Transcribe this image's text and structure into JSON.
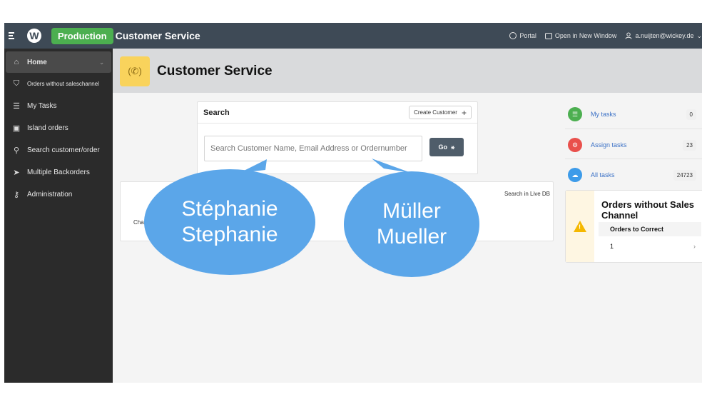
{
  "topbar": {
    "logo_letter": "W",
    "environment": "Production",
    "app_title": "Customer Service",
    "portal_label": "Portal",
    "open_window_label": "Open in New Window",
    "user_label": "a.nuijten@wickey.de"
  },
  "sidebar": {
    "items": [
      {
        "label": "Home",
        "icon": "home-icon"
      },
      {
        "label": "Orders without saleschannel",
        "icon": "shield-icon"
      },
      {
        "label": "My Tasks",
        "icon": "list-icon"
      },
      {
        "label": "Island orders",
        "icon": "gift-icon"
      },
      {
        "label": "Search customer/order",
        "icon": "search-icon"
      },
      {
        "label": "Multiple Backorders",
        "icon": "send-icon"
      },
      {
        "label": "Administration",
        "icon": "user-key-icon"
      }
    ]
  },
  "header": {
    "title": "Customer Service",
    "icon": "phone-ringing-icon"
  },
  "search": {
    "title": "Search",
    "create_label": "Create Customer",
    "placeholder": "Search Customer Name, Email Address or Ordernumber",
    "go_label": "Go"
  },
  "results": {
    "live_db_label": "Search in Live DB",
    "chan_label": "Chan"
  },
  "bubbles": {
    "left": {
      "line1": "Stéphanie",
      "line2": "Stephanie"
    },
    "right": {
      "line1": "Müller",
      "line2": "Mueller"
    }
  },
  "tasks": [
    {
      "label": "My tasks",
      "count": "0",
      "color": "#4caf50",
      "icon": "list-icon"
    },
    {
      "label": "Assign tasks",
      "count": "23",
      "color": "#e9504c",
      "icon": "gear-icon"
    },
    {
      "label": "All tasks",
      "count": "24723",
      "color": "#3d9be9",
      "icon": "cloud-icon"
    }
  ],
  "orders_without_channel": {
    "title": "Orders without Sales Channel",
    "column_header": "Orders to Correct",
    "value": "1"
  }
}
